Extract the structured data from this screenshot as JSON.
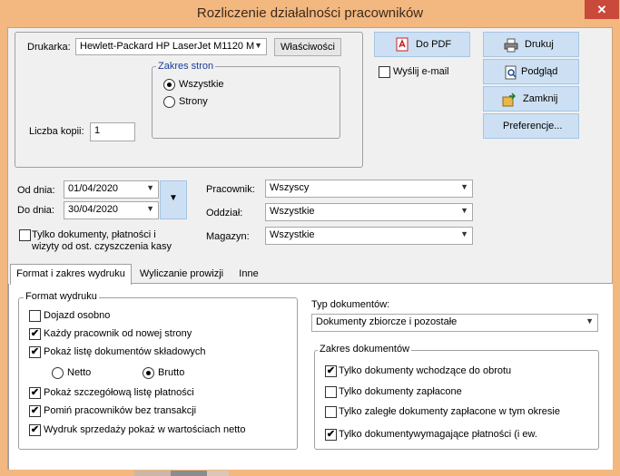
{
  "window": {
    "title": "Rozliczenie działalności pracowników",
    "close": "✕"
  },
  "printer": {
    "label": "Drukarka:",
    "value": "Hewlett-Packard HP LaserJet M1120 M",
    "properties": "Właściwości",
    "range_legend": "Zakres stron",
    "all": "Wszystkie",
    "pages": "Strony",
    "copies_label": "Liczba kopii:",
    "copies_value": "1"
  },
  "actions": {
    "pdf": "Do PDF",
    "print": "Drukuj",
    "preview": "Podgląd",
    "close": "Zamknij",
    "prefs": "Preferencje...",
    "email": "Wyślij e-mail"
  },
  "dates": {
    "from_label": "Od dnia:",
    "from_value": "01/04/2020",
    "to_label": "Do dnia:",
    "to_value": "30/04/2020"
  },
  "only_docs": {
    "line1": "Tylko dokumenty, płatności i",
    "line2": "wizyty od ost. czyszczenia kasy"
  },
  "filters": {
    "employee_label": "Pracownik:",
    "employee_value": "Wszyscy",
    "dept_label": "Oddział:",
    "dept_value": "Wszystkie",
    "store_label": "Magazyn:",
    "store_value": "Wszystkie"
  },
  "tabs": [
    "Format i zakres wydruku",
    "Wyliczanie prowizji",
    "Inne"
  ],
  "format": {
    "legend": "Format wydruku",
    "items": [
      {
        "label": "Dojazd osobno",
        "checked": false
      },
      {
        "label": "Każdy pracownik od nowej strony",
        "checked": true
      },
      {
        "label": "Pokaż listę dokumentów składowych",
        "checked": true
      },
      {
        "label": "Pokaż szczegółową listę płatności",
        "checked": true
      },
      {
        "label": "Pomiń pracowników bez transakcji",
        "checked": true
      },
      {
        "label": "Wydruk sprzedaży pokaż w wartościach netto",
        "checked": true
      }
    ],
    "netto": "Netto",
    "brutto": "Brutto"
  },
  "doc_type": {
    "label": "Typ dokumentów:",
    "value": "Dokumenty zbiorcze i pozostałe"
  },
  "doc_range": {
    "legend": "Zakres dokumentów",
    "items": [
      {
        "label": "Tylko dokumenty wchodzące do obrotu",
        "checked": true
      },
      {
        "label": "Tylko dokumenty zapłacone",
        "checked": false
      },
      {
        "label": "Tylko zaległe dokumenty zapłacone w tym okresie",
        "checked": false
      },
      {
        "label": "Tylko dokumentywymagające płatności (i ew.",
        "checked": true
      }
    ]
  },
  "colors": {
    "titlebar": "#f2b880",
    "close": "#c94a3a",
    "button_blue": "#cde0f3"
  }
}
